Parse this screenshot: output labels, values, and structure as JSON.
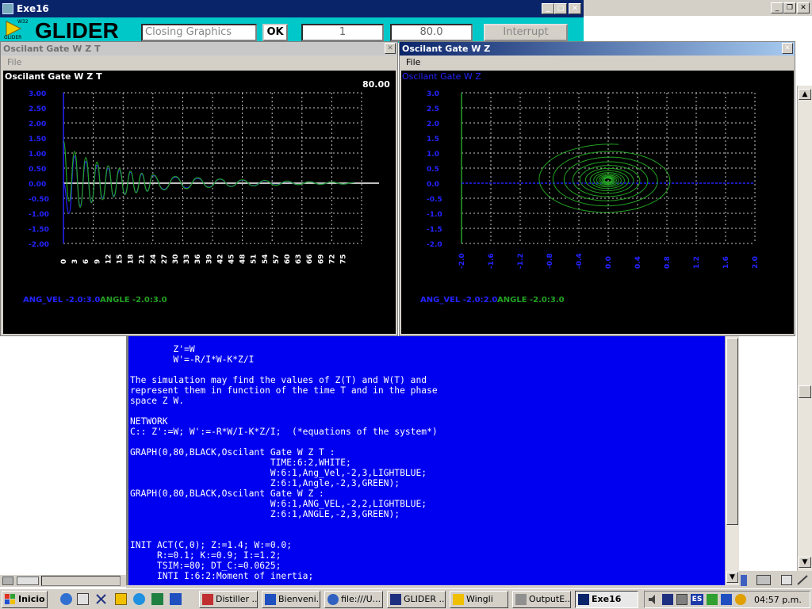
{
  "main_window": {
    "title": "Exe16",
    "logo_text": "GLIDER",
    "logo_sub": "W32",
    "logo_badge": "GLIDER",
    "status_field": "Closing Graphics",
    "ok_label": "OK",
    "step_field": "1",
    "time_field": "80.0",
    "interrupt_label": "Interrupt"
  },
  "graph1": {
    "window_title": "Oscilant Gate W Z T",
    "menu_file": "File",
    "heading": "Oscilant Gate W Z T",
    "time_readout": "80.00",
    "legend_series1": "ANG_VEL -2.0:3.0",
    "legend_series2": "ANGLE -2.0:3.0",
    "colors": {
      "series1": "#2323ff",
      "series2": "#22a022",
      "axis": "#2323ff",
      "grid": "#c8c8c8"
    }
  },
  "graph2": {
    "window_title": "Oscilant Gate W Z",
    "menu_file": "File",
    "heading": "Oscilant Gate W Z",
    "legend_series1": "ANG_VEL -2.0:2.0",
    "legend_series2": "ANGLE -2.0:3.0",
    "colors": {
      "curve": "#22a022",
      "axis": "#2323ff",
      "grid": "#c8c8c8"
    }
  },
  "chart_data": [
    {
      "type": "line",
      "title": "Oscilant Gate W Z T",
      "x_ticks": [
        "0",
        "3",
        "6",
        "9",
        "12",
        "15",
        "18",
        "21",
        "24",
        "27",
        "30",
        "33",
        "36",
        "39",
        "42",
        "45",
        "48",
        "51",
        "54",
        "57",
        "60",
        "63",
        "66",
        "69",
        "72",
        "75"
      ],
      "y_ticks": [
        "3.00",
        "2.50",
        "2.00",
        "1.50",
        "1.00",
        "0.50",
        "0.00",
        "-0.50",
        "-1.00",
        "-1.50",
        "-2.00"
      ],
      "xlim": [
        0,
        80
      ],
      "ylim": [
        -2,
        3
      ],
      "grid": true,
      "legend": "bottom-left",
      "series": [
        {
          "name": "ANG_VEL",
          "color": "#2323ff",
          "x": [
            0,
            1.5,
            3,
            4.5,
            6,
            7.5,
            9,
            10.5,
            12,
            13.5,
            15,
            16.5,
            18,
            19.5,
            21,
            22.5,
            24,
            27,
            30,
            33,
            36,
            39,
            42,
            45,
            48,
            51,
            54,
            57,
            60,
            63,
            66,
            69,
            72,
            75,
            78
          ],
          "y": [
            0,
            -1.0,
            0.9,
            -0.75,
            0.72,
            -0.62,
            0.6,
            -0.5,
            0.5,
            -0.42,
            0.42,
            -0.35,
            0.36,
            -0.3,
            0.3,
            -0.25,
            0.26,
            -0.2,
            0.2,
            -0.16,
            0.16,
            -0.13,
            0.13,
            -0.1,
            0.1,
            -0.08,
            0.08,
            -0.06,
            0.06,
            -0.05,
            0.05,
            -0.04,
            0.04,
            -0.03,
            0.02
          ]
        },
        {
          "name": "ANGLE",
          "color": "#22a022",
          "x": [
            0,
            1.5,
            3,
            4.5,
            6,
            7.5,
            9,
            10.5,
            12,
            13.5,
            15,
            16.5,
            18,
            19.5,
            21,
            22.5,
            24,
            27,
            30,
            33,
            36,
            39,
            42,
            45,
            48,
            51,
            54,
            57,
            60,
            63,
            66,
            69,
            72,
            75,
            78
          ],
          "y": [
            1.4,
            -0.6,
            1.05,
            -0.8,
            0.85,
            -0.65,
            0.7,
            -0.55,
            0.58,
            -0.45,
            0.48,
            -0.38,
            0.4,
            -0.32,
            0.33,
            -0.27,
            0.28,
            -0.22,
            0.22,
            -0.18,
            0.18,
            -0.14,
            0.14,
            -0.11,
            0.11,
            -0.09,
            0.09,
            -0.07,
            0.07,
            -0.05,
            0.05,
            -0.04,
            0.04,
            -0.03,
            0.02
          ]
        }
      ]
    },
    {
      "type": "scatter",
      "title": "Oscilant Gate W Z",
      "x_ticks": [
        "-2.0",
        "-1.6",
        "-1.2",
        "-0.8",
        "-0.4",
        "0.0",
        "0.4",
        "0.8",
        "1.2",
        "1.6",
        "2.0"
      ],
      "y_ticks": [
        "3.0",
        "2.5",
        "2.0",
        "1.5",
        "1.0",
        "0.5",
        "0.0",
        "-0.5",
        "-1.0",
        "-1.5",
        "-2.0"
      ],
      "xlim": [
        -2,
        2
      ],
      "ylim": [
        -2,
        3
      ],
      "grid": true,
      "legend": "bottom-left",
      "spiral": {
        "start_angle_z": 1.4,
        "start_ang_vel": 0.0,
        "z_amplitude_start": 1.0,
        "w_amplitude_start": 1.2,
        "decay_per_turn": 0.8,
        "turns": 14,
        "center": [
          0,
          0.1
        ]
      }
    }
  ],
  "editor": {
    "lines": [
      "        Z'=W",
      "        W'=-R/I*W-K*Z/I",
      "",
      "The simulation may find the values of Z(T) and W(T) and",
      "represent them in function of the time T and in the phase",
      "space Z W.",
      "",
      "NETWORK",
      "C:: Z':=W; W':=-R*W/I-K*Z/I;  (*equations of the system*)",
      "",
      "GRAPH(0,80,BLACK,Oscilant Gate W Z T :",
      "                          TIME:6:2,WHITE;",
      "                          W:6:1,Ang_Vel,-2,3,LIGHTBLUE;",
      "                          Z:6:1,Angle,-2,3,GREEN);",
      "GRAPH(0,80,BLACK,Oscilant Gate W Z :",
      "                          W:6:1,ANG_VEL,-2,2,LIGHTBLUE;",
      "                          Z:6:1,ANGLE,-2,3,GREEN);",
      "",
      "",
      "INIT ACT(C,0); Z:=1.4; W:=0.0;",
      "     R:=0.1; K:=0.9; I:=1.2;",
      "     TSIM:=80; DT_C:=0.0625;",
      "     INTI I:6:2:Moment of inertia;"
    ]
  },
  "taskbar": {
    "start_label": "Inicio",
    "buttons": [
      "Distiller ...",
      "Bienveni...",
      "file:///U...",
      "GLIDER ...",
      "Wingli",
      "OutputE...",
      "Exe16"
    ],
    "lang": "ES",
    "clock": "04:57 p.m."
  }
}
